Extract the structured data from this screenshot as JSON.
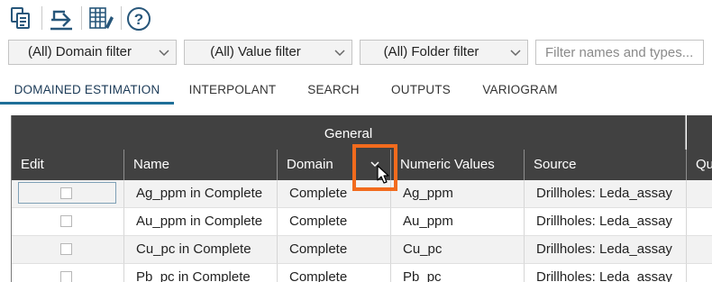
{
  "toolbar": {
    "buttons": [
      {
        "name": "copy-icon"
      },
      {
        "name": "export-icon"
      },
      {
        "name": "grid-edit-icon"
      },
      {
        "name": "help-icon"
      }
    ]
  },
  "filters": {
    "domain": "(All) Domain filter",
    "value": "(All) Value filter",
    "folder": "(All) Folder filter",
    "search_placeholder": "Filter names and types..."
  },
  "tabs": [
    {
      "label": "DOMAINED ESTIMATION",
      "active": true
    },
    {
      "label": "INTERPOLANT",
      "active": false
    },
    {
      "label": "SEARCH",
      "active": false
    },
    {
      "label": "OUTPUTS",
      "active": false
    },
    {
      "label": "VARIOGRAM",
      "active": false
    }
  ],
  "grid": {
    "group_header": "General",
    "columns": [
      "Edit",
      "Name",
      "Domain",
      "Numeric Values",
      "Source",
      "Qu"
    ],
    "rows": [
      {
        "name": "Ag_ppm in Complete",
        "domain": "Complete",
        "numeric": "Ag_ppm",
        "source": "Drillholes: Leda_assay"
      },
      {
        "name": "Au_ppm in Complete",
        "domain": "Complete",
        "numeric": "Au_ppm",
        "source": "Drillholes: Leda_assay"
      },
      {
        "name": "Cu_pc in Complete",
        "domain": "Complete",
        "numeric": "Cu_pc",
        "source": "Drillholes: Leda_assay"
      },
      {
        "name": "Pb_pc in Complete",
        "domain": "Complete",
        "numeric": "Pb_pc",
        "source": "Drillholes: Leda_assay"
      }
    ]
  },
  "colors": {
    "header_bg": "#414141",
    "accent": "#1f6f98",
    "highlight": "#f26b1d"
  }
}
